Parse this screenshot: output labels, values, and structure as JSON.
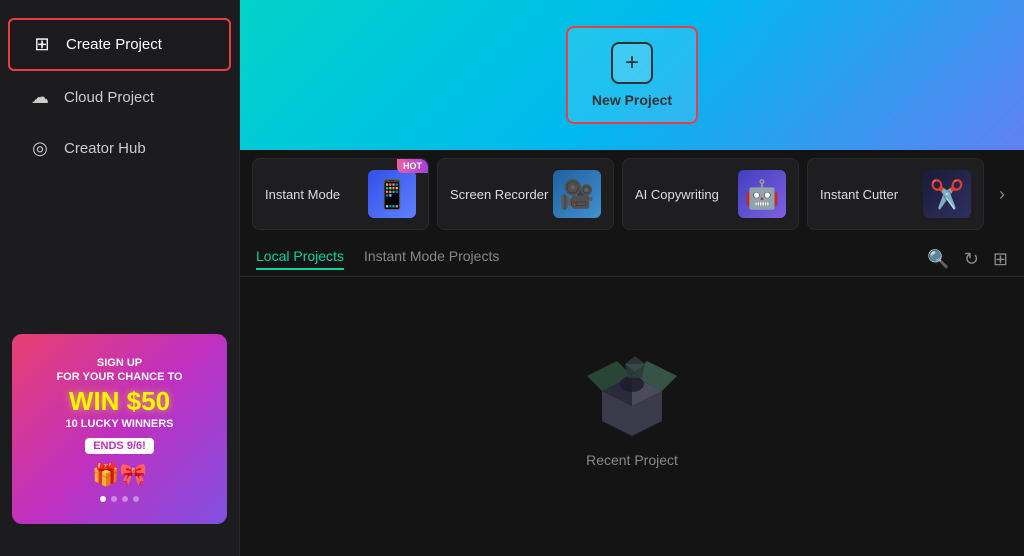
{
  "sidebar": {
    "items": [
      {
        "id": "create-project",
        "label": "Create Project",
        "icon": "⊞",
        "active": true
      },
      {
        "id": "cloud-project",
        "label": "Cloud Project",
        "icon": "☁",
        "active": false
      },
      {
        "id": "creator-hub",
        "label": "Creator Hub",
        "icon": "◎",
        "active": false
      }
    ]
  },
  "ad": {
    "line1": "SIGN UP",
    "line2": "FOR YOUR CHANCE TO",
    "win_amount": "WIN $50",
    "lucky": "10 LUCKY WINNERS",
    "ends": "ENDS 9/6!",
    "icons": "🎁🎀"
  },
  "hero": {
    "new_project_label": "New Project",
    "new_project_icon": "+"
  },
  "tools": [
    {
      "id": "instant-mode",
      "name": "Instant Mode",
      "hot": true,
      "emoji": "📱"
    },
    {
      "id": "screen-recorder",
      "name": "Screen Recorder",
      "hot": false,
      "emoji": "🎥"
    },
    {
      "id": "ai-copywriting",
      "name": "AI Copywriting",
      "hot": false,
      "emoji": "🤖"
    },
    {
      "id": "instant-cutter",
      "name": "Instant Cutter",
      "hot": false,
      "emoji": "✂️"
    }
  ],
  "tabs": [
    {
      "id": "local",
      "label": "Local Projects",
      "active": true
    },
    {
      "id": "instant",
      "label": "Instant Mode Projects",
      "active": false
    }
  ],
  "actions": {
    "search_icon": "🔍",
    "refresh_icon": "↻",
    "grid_icon": "⊞"
  },
  "empty_state": {
    "label": "Recent Project"
  },
  "hot_badge": "HOT"
}
